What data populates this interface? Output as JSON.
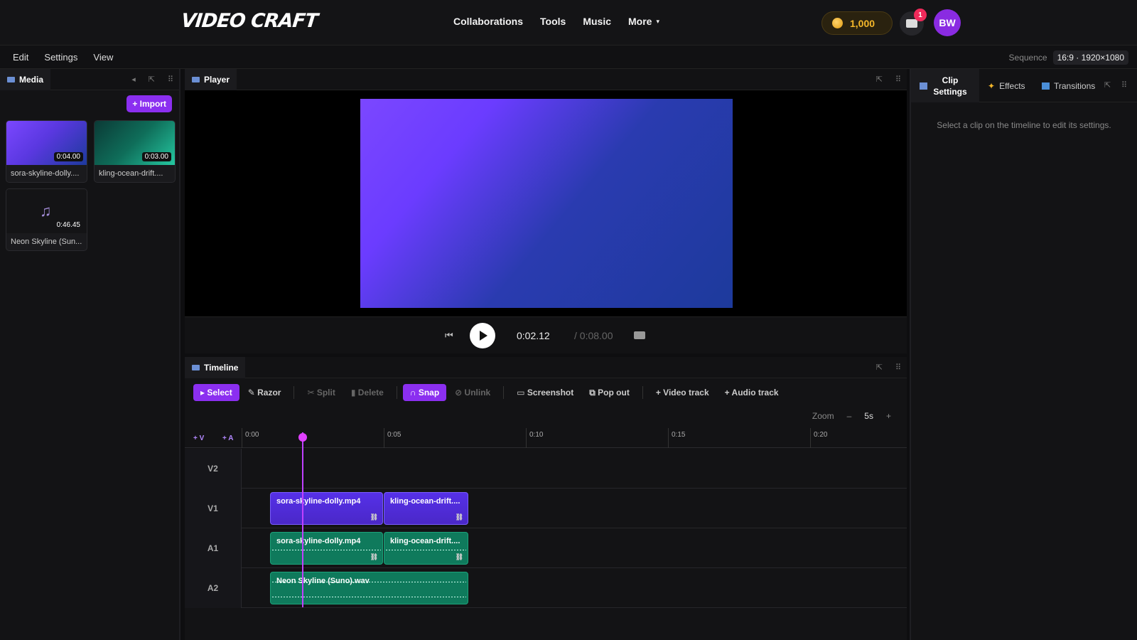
{
  "app": {
    "logo": "VIDEO CRAFT"
  },
  "nav": {
    "items": [
      "Collaborations",
      "Tools",
      "Music",
      "More"
    ]
  },
  "header": {
    "coins": "1,000",
    "notifications": "1",
    "avatar_initials": "BW"
  },
  "menubar": {
    "items": [
      "Edit",
      "Settings",
      "View"
    ],
    "sequence_label": "Sequence",
    "sequence_value": "16:9 · 1920×1080"
  },
  "media": {
    "tab": "Media",
    "import_label": "+ Import",
    "items": [
      {
        "name": "sora-skyline-dolly....",
        "duration": "0:04.00"
      },
      {
        "name": "kling-ocean-drift....",
        "duration": "0:03.00"
      },
      {
        "name": "Neon Skyline (Sun...",
        "duration": "0:46.45"
      }
    ]
  },
  "player": {
    "tab": "Player",
    "current_time": "0:02.12",
    "total_time": "/ 0:08.00"
  },
  "inspector": {
    "tabs": [
      "Clip Settings",
      "Effects",
      "Transitions"
    ],
    "hint": "Select a clip on the timeline to edit its settings."
  },
  "timeline": {
    "tab": "Timeline",
    "tools": [
      "Select",
      "Razor",
      "Split",
      "Delete",
      "Snap",
      "Unlink",
      "Screenshot",
      "Pop out",
      "+ Video track",
      "+ Audio track"
    ],
    "zoom_label": "Zoom",
    "zoom_minus": "–",
    "zoom_value": "5s",
    "zoom_plus": "+",
    "add_video": "+ V",
    "add_audio": "+ A",
    "ticks": [
      "0:00",
      "0:05",
      "0:10",
      "0:15",
      "0:20"
    ],
    "tracks": [
      "V2",
      "V1",
      "A1",
      "A2"
    ],
    "clips": {
      "v1_a": "sora-skyline-dolly.mp4",
      "v1_b": "kling-ocean-drift....",
      "a1_a": "sora-skyline-dolly.mp4",
      "a1_b": "kling-ocean-drift....",
      "a2_a": "Neon Skyline (Suno).wav"
    },
    "playhead_time": "0:02.12"
  },
  "colors": {
    "accent": "#8b2ff0",
    "video_clip": "#5630e8",
    "audio_clip": "#0f7a5c",
    "playhead": "#e040ff"
  }
}
